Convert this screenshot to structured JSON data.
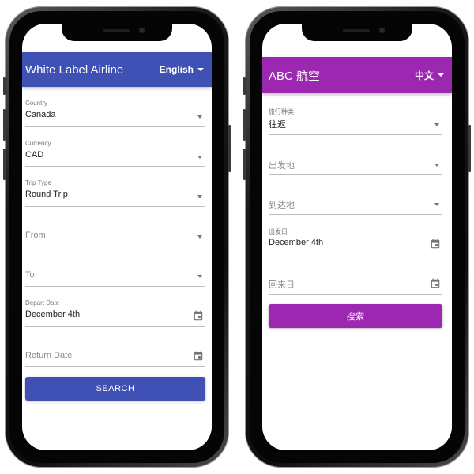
{
  "colors": {
    "left_accent": "#3f51b5",
    "right_accent": "#9c27b0"
  },
  "left": {
    "appbar": {
      "title": "White Label Airline",
      "language": "English"
    },
    "fields": {
      "country": {
        "label": "Country",
        "value": "Canada"
      },
      "currency": {
        "label": "Currency",
        "value": "CAD"
      },
      "trip_type": {
        "label": "Trip Type",
        "value": "Round Trip"
      },
      "from": {
        "placeholder": "From"
      },
      "to": {
        "placeholder": "To"
      },
      "depart_date": {
        "label": "Depart Date",
        "value": "December 4th"
      },
      "return_date": {
        "placeholder": "Return Date"
      }
    },
    "search_label": "SEARCH"
  },
  "right": {
    "appbar": {
      "title": "ABC 航空",
      "language": "中文"
    },
    "fields": {
      "trip_type": {
        "label": "旅行种类",
        "value": "往返"
      },
      "from": {
        "placeholder": "出发地"
      },
      "to": {
        "placeholder": "到达地"
      },
      "depart_date": {
        "label": "出发日",
        "value": "December 4th"
      },
      "return_date": {
        "placeholder": "回来日"
      }
    },
    "search_label": "搜索"
  }
}
